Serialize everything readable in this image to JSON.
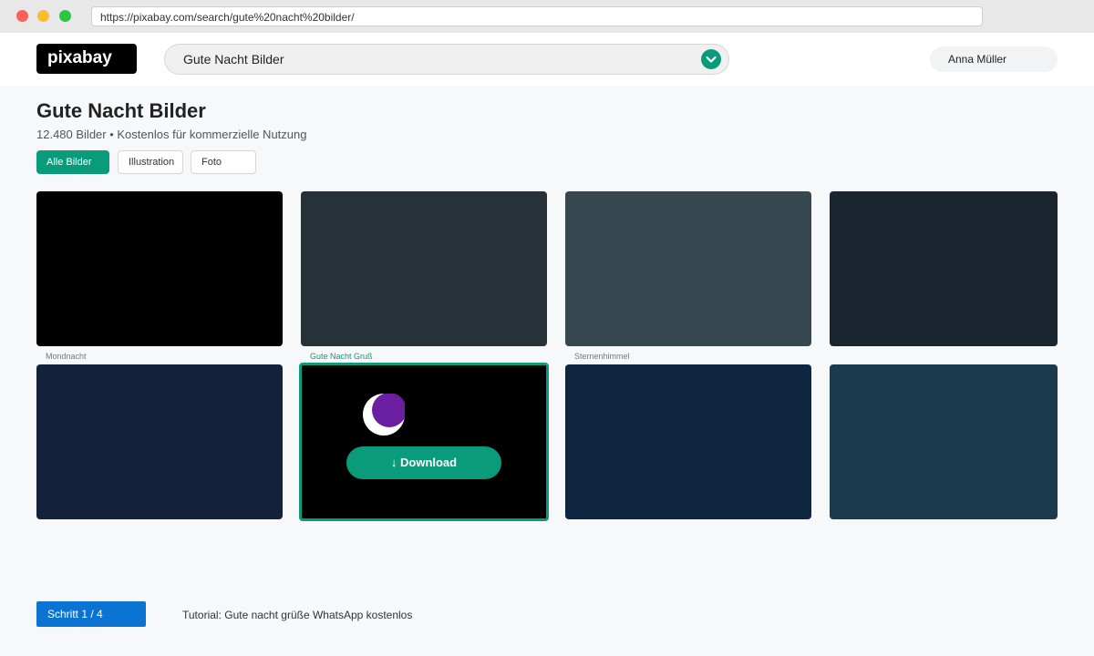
{
  "browser": {
    "url": "https://pixabay.com/search/gute%20nacht%20bilder/"
  },
  "header": {
    "logo": "pixabay",
    "search_value": "Gute Nacht Bilder",
    "user_name": "Anna Müller"
  },
  "page": {
    "title": "Gute Nacht Bilder",
    "subtitle": "12.480 Bilder • Kostenlos für kommerzielle Nutzung",
    "filters": [
      {
        "label": "Alle Bilder",
        "active": true
      },
      {
        "label": "Illustration",
        "active": false
      },
      {
        "label": "Foto",
        "active": false
      }
    ]
  },
  "gallery": {
    "captions": [
      "Mondnacht",
      "Gute Nacht Gruß",
      "Sternenhimmel"
    ],
    "download_label": "↓ Download",
    "colors": {
      "accent": "#0a9c7a",
      "tiles": [
        "#000000",
        "#263238",
        "#37474f",
        "#1b2530",
        "#13223a",
        "#000000",
        "#0f2640",
        "#1b3a4d"
      ],
      "moon": "#ffffff",
      "moon_shadow": "#6a1fa0"
    }
  },
  "tutorial": {
    "step_label": "Schritt 1 / 4",
    "text": "Tutorial: Gute nacht grüße WhatsApp kostenlos"
  }
}
